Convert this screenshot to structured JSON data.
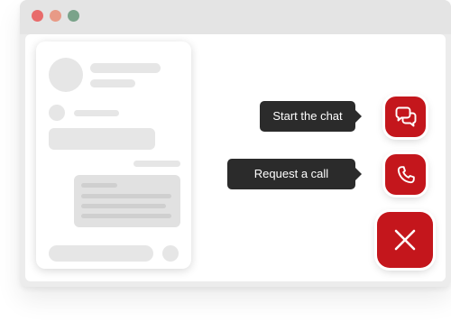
{
  "colors": {
    "accent": "#c4161c",
    "tooltip_bg": "#2b2b2b",
    "tooltip_text": "#ffffff",
    "window_chrome": "#e4e4e4",
    "skeleton": "#e6e6e6"
  },
  "window_controls": [
    {
      "name": "close",
      "color": "#e86b6b"
    },
    {
      "name": "minimize",
      "color": "#e89a86"
    },
    {
      "name": "maximize",
      "color": "#7aa38a"
    }
  ],
  "actions": {
    "chat": {
      "label": "Start the chat",
      "icon": "chat-bubbles-icon"
    },
    "call": {
      "label": "Request a call",
      "icon": "phone-icon"
    },
    "close": {
      "icon": "close-x-icon"
    }
  }
}
